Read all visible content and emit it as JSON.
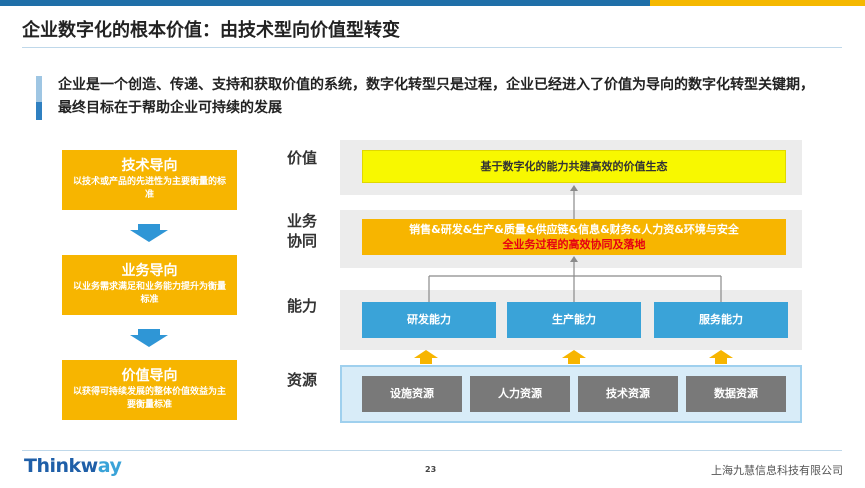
{
  "title": "企业数字化的根本价值：由技术型向价值型转变",
  "lead_text": "企业是一个创造、传递、支持和获取价值的系统，数字化转型只是过程，企业已经进入了价值为导向的数字化转型关键期，最终目标在于帮助企业可持续的发展",
  "left_column": [
    {
      "title": "技术导向",
      "desc": "以技术或产品的先进性为主要衡量的标准"
    },
    {
      "title": "业务导向",
      "desc": "以业务需求满足和业务能力提升为衡量标准"
    },
    {
      "title": "价值导向",
      "desc": "以获得可持续发展的整体价值效益为主要衡量标准"
    }
  ],
  "rows": {
    "value": {
      "label": "价值",
      "box": "基于数字化的能力共建高效的价值生态"
    },
    "collab": {
      "label_line1": "业务",
      "label_line2": "协同",
      "box_line1": "销售&研发&生产&质量&供应链&信息&财务&人力资&环境与安全",
      "box_line2": "全业务过程的高效协同及落地"
    },
    "capability": {
      "label": "能力",
      "items": [
        "研发能力",
        "生产能力",
        "服务能力"
      ]
    },
    "resource": {
      "label": "资源",
      "items": [
        "设施资源",
        "人力资源",
        "技术资源",
        "数据资源"
      ]
    }
  },
  "colors": {
    "brand_blue": "#1f6fa8",
    "accent_yellow": "#f5b800",
    "orange_box": "#f7b500",
    "value_yellow": "#f8f800",
    "capability_blue": "#3aa3d8",
    "resource_gray": "#797979",
    "highlight_red": "#e60012"
  },
  "footer": {
    "logo_main": "Thinkw",
    "logo_accent": "ay",
    "page_number": "23",
    "company": "上海九慧信息科技有限公司"
  }
}
